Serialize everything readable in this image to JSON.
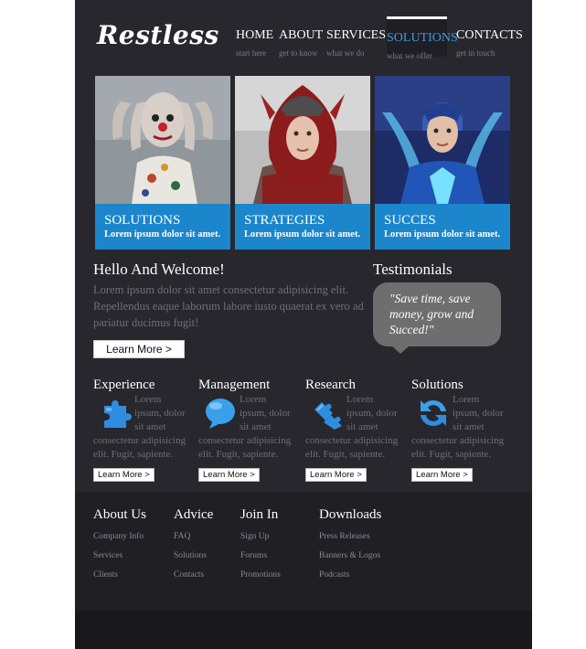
{
  "brand": {
    "logo": "Restless"
  },
  "nav": [
    {
      "label": "HOME",
      "sub": "start here"
    },
    {
      "label": "ABOUT",
      "sub": "get to know"
    },
    {
      "label": "SERVICES",
      "sub": "what we do"
    },
    {
      "label": "SOLUTIONS",
      "sub": "what we offer",
      "active": true
    },
    {
      "label": "CONTACTS",
      "sub": "get in touch"
    }
  ],
  "cards": [
    {
      "title": "SOLUTIONS",
      "text": "Lorem ipsum dolor sit amet."
    },
    {
      "title": "STRATEGIES",
      "text": "Lorem ipsum dolor sit amet."
    },
    {
      "title": "SUCCES",
      "text": "Lorem ipsum dolor sit amet."
    }
  ],
  "welcome": {
    "title": "Hello And Welcome!",
    "text": "Lorem ipsum dolor sit amet consectetur adipisicing elit. Repellendus eaque laborum labore iusto quaerat ex vero ad pariatur ducimus fugit!",
    "button": "Learn More >"
  },
  "testimonials": {
    "title": "Testimonials",
    "quote": "\"Save time, save money, grow and Succed!\""
  },
  "features": [
    {
      "title": "Experience",
      "icon": "puzzle-icon",
      "lines": [
        "Lorem",
        "ipsum, dolor",
        "sit amet"
      ],
      "tail": [
        "consectetur adipisicing",
        "elit. Fugit, sapiente."
      ],
      "button": "Learn More >"
    },
    {
      "title": "Management",
      "icon": "speech-bubble-icon",
      "lines": [
        "Lorem",
        "ipsum, dolor",
        "sit amet"
      ],
      "tail": [
        "consectetur adipisicing",
        "elit. Fugit, sapiente."
      ],
      "button": "Learn More >"
    },
    {
      "title": "Research",
      "icon": "puzzle-pieces-icon",
      "lines": [
        "Lorem",
        "ipsum, dolor",
        "sit amet"
      ],
      "tail": [
        "consectetur adipisicing",
        "elit. Fugit, sapiente."
      ],
      "button": "Learn More >"
    },
    {
      "title": "Solutions",
      "icon": "refresh-arrows-icon",
      "lines": [
        "Lorem",
        "ipsum, dolor",
        "sit amet"
      ],
      "tail": [
        "consectetur adipisicing",
        "elit. Fugit, sapiente."
      ],
      "button": "Learn More >"
    }
  ],
  "footer": [
    {
      "title": "About Us",
      "links": [
        "Company Info",
        "Services",
        "Clients"
      ]
    },
    {
      "title": "Advice",
      "links": [
        "FAQ",
        "Solutions",
        "Contacts"
      ]
    },
    {
      "title": "Join In",
      "links": [
        "Sign Up",
        "Forums",
        "Promotions"
      ]
    },
    {
      "title": "Downloads",
      "links": [
        "Press Releases",
        "Banners & Logos",
        "Podcasts"
      ]
    }
  ],
  "colors": {
    "page_bg": "#27272d",
    "accent_blue": "#1b86cb",
    "active_nav": "#3a9ee0",
    "bubble": "#6e6e6e"
  }
}
